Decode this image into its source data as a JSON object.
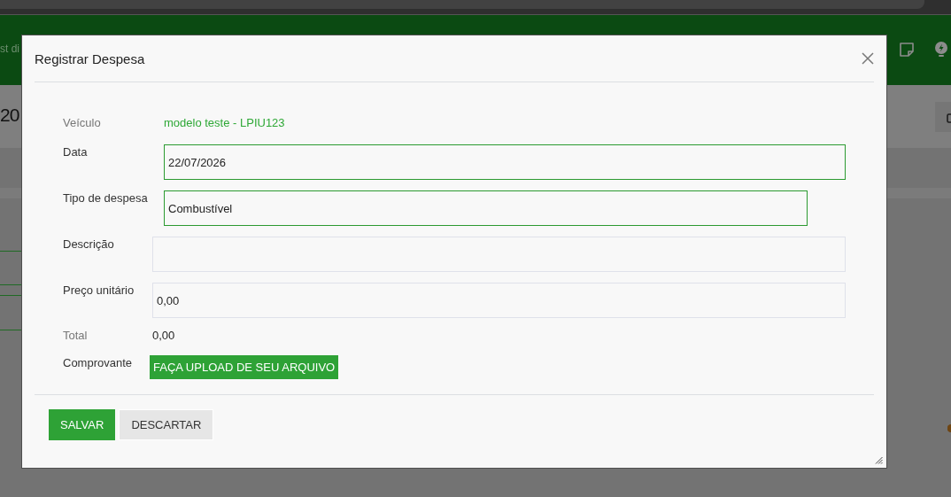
{
  "app_header": {
    "title": "st di"
  },
  "page": {
    "heading": "20"
  },
  "dialog": {
    "title": "Registrar Despesa",
    "fields": [
      {
        "kind": "link",
        "label": "Veículo",
        "value": "modelo teste - LPIU123"
      },
      {
        "kind": "date",
        "label": "Data",
        "value": "22/07/2026",
        "valid": true
      },
      {
        "kind": "select",
        "label": "Tipo de despesa",
        "value": "Combustível",
        "valid": true
      },
      {
        "kind": "text",
        "label": "Descrição",
        "valid": false
      },
      {
        "kind": "number",
        "label": "Preço unitário",
        "value": "0,00",
        "valid": false
      },
      {
        "kind": "static",
        "label": "Total",
        "value": "0,00"
      },
      {
        "kind": "upload",
        "label": "Comprovante",
        "button": "FAÇA UPLOAD DE SEU ARQUIVO"
      }
    ],
    "buttons": [
      {
        "kind": "primary",
        "label": "SALVAR"
      },
      {
        "kind": "secondary",
        "label": "DESCARTAR"
      }
    ]
  }
}
